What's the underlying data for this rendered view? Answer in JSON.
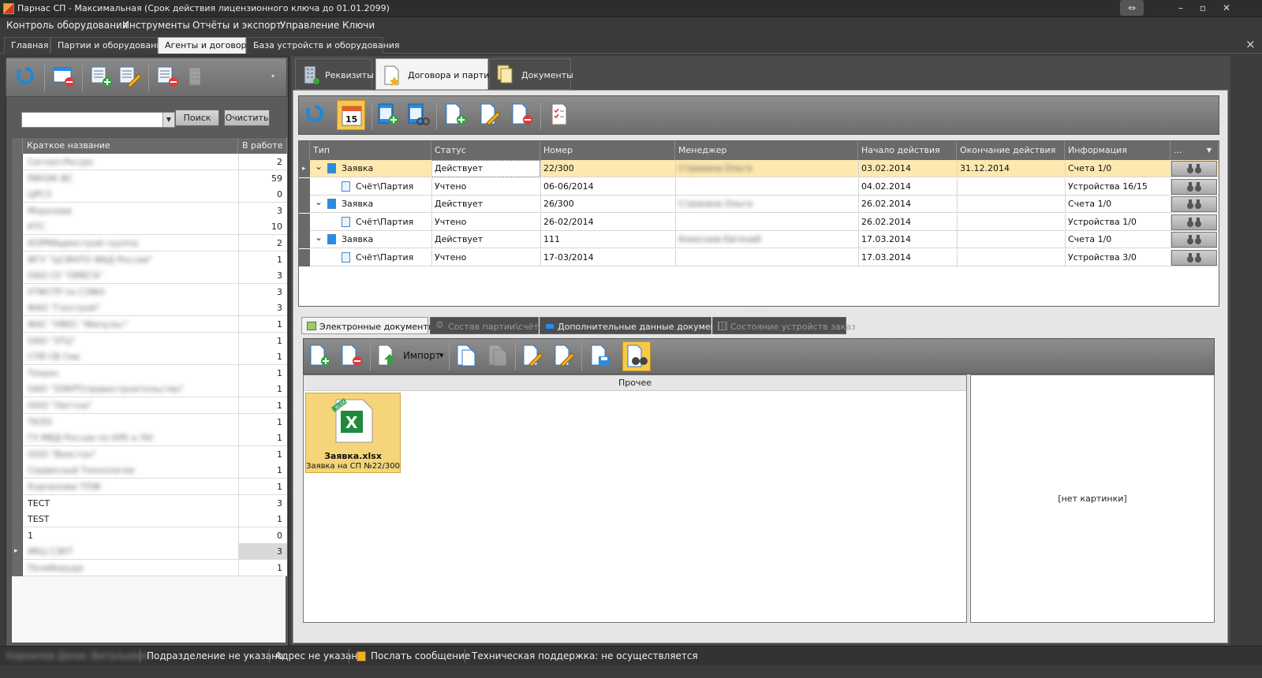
{
  "window": {
    "title": "Парнас СП - Максимальная (Срок действия лицензионного ключа до 01.01.2099)",
    "controls": {
      "restore": "⇔",
      "minimize": "–",
      "maximize": "▫",
      "close": "✕"
    }
  },
  "menu": [
    "Контроль оборудования",
    "Инструменты",
    "Отчёты и экспорт",
    "Управление",
    "Ключи"
  ],
  "main_tabs": [
    {
      "label": "Главная"
    },
    {
      "label": "Партии и оборудование"
    },
    {
      "label": "Агенты и договора",
      "active": true
    },
    {
      "label": "База устройств и оборудования"
    }
  ],
  "main_close": "×",
  "left": {
    "search_button": "Поиск",
    "clear_button": "Очистить",
    "columns": [
      "Краткое название",
      "В работе"
    ],
    "rows": [
      {
        "name": "Сигнал-Ресурс",
        "count": "2",
        "blurred": true
      },
      {
        "name": "РИНЭК ВС",
        "count": "59",
        "blurred": true
      },
      {
        "name": "ЦРСЗ",
        "count": "0",
        "blurred": true
      },
      {
        "name": "Морозова",
        "count": "3",
        "blurred": true
      },
      {
        "name": "КТС",
        "count": "10",
        "blurred": true
      },
      {
        "name": "КОРМАдмострой группа",
        "count": "2",
        "blurred": true
      },
      {
        "name": "ФГУ \"ЦСФНТО ФБД России\"",
        "count": "1",
        "blurred": true
      },
      {
        "name": "ОАО СУ \"ОМЕГА\"",
        "count": "3",
        "blurred": true
      },
      {
        "name": "УТФСТР по СЗФО",
        "count": "3",
        "blurred": true
      },
      {
        "name": "ФАО \"Газстрой\"",
        "count": "3",
        "blurred": true
      },
      {
        "name": "ФАС \"УФЕС \"Импульс\"",
        "count": "1",
        "blurred": true
      },
      {
        "name": "ОАО \"ЗТЦ\"",
        "count": "1",
        "blurred": true
      },
      {
        "name": "СТЙ СВ Сев",
        "count": "1",
        "blurred": true
      },
      {
        "name": "Техрос",
        "count": "1",
        "blurred": true
      },
      {
        "name": "ОАО \"ЭЗКРТ(правостроительство\"",
        "count": "1",
        "blurred": true
      },
      {
        "name": "ООО \"Литтна\"",
        "count": "1",
        "blurred": true
      },
      {
        "name": "ТКЛЭ",
        "count": "1",
        "blurred": true
      },
      {
        "name": "ГУ МВД России по КРЕ и ЛН",
        "count": "1",
        "blurred": true
      },
      {
        "name": "ООО \"Веестон\"",
        "count": "1",
        "blurred": true
      },
      {
        "name": "Сервисный Технологии",
        "count": "1",
        "blurred": true
      },
      {
        "name": "Корнилова ТПЖ",
        "count": "1",
        "blurred": true
      },
      {
        "name": "ТЕСТ",
        "count": "3",
        "blurred": false
      },
      {
        "name": "TEST",
        "count": "1",
        "blurred": false
      },
      {
        "name": "1",
        "count": "0",
        "blurred": false
      },
      {
        "name": "ИКЦ СЗКТ",
        "count": "3",
        "blurred": true,
        "current": true
      },
      {
        "name": "Полиборуда",
        "count": "1",
        "blurred": true
      }
    ]
  },
  "right_tabs": [
    {
      "label": "Реквизиты"
    },
    {
      "label": "Договора и партии",
      "active": true
    },
    {
      "label": "Документы"
    }
  ],
  "calendar_day": "15",
  "grid": {
    "columns": [
      "Тип",
      "Статус",
      "Номер",
      "Менеджер",
      "Начало действия",
      "Окончание действия",
      "Информация",
      "..."
    ],
    "rows": [
      {
        "level": 0,
        "type": "Заявка",
        "status": "Действует",
        "number": "22/300",
        "manager": "Строкина Ольга",
        "start": "03.02.2014",
        "end": "31.12.2014",
        "info": "Счета  1/0",
        "selected": true
      },
      {
        "level": 1,
        "type": "Счёт\\Партия",
        "status": "Учтено",
        "number": "06-06/2014",
        "manager": "",
        "start": "04.02.2014",
        "end": "",
        "info": "Устройства  16/15"
      },
      {
        "level": 0,
        "type": "Заявка",
        "status": "Действует",
        "number": "26/300",
        "manager": "Строкина Ольга",
        "start": "26.02.2014",
        "end": "",
        "info": "Счета  1/0"
      },
      {
        "level": 1,
        "type": "Счёт\\Партия",
        "status": "Учтено",
        "number": "26-02/2014",
        "manager": "",
        "start": "26.02.2014",
        "end": "",
        "info": "Устройства  1/0"
      },
      {
        "level": 0,
        "type": "Заявка",
        "status": "Действует",
        "number": "111",
        "manager": "Алексеев Евгений",
        "start": "17.03.2014",
        "end": "",
        "info": "Счета  1/0"
      },
      {
        "level": 1,
        "type": "Счёт\\Партия",
        "status": "Учтено",
        "number": "17-03/2014",
        "manager": "",
        "start": "17.03.2014",
        "end": "",
        "info": "Устройства  3/0"
      }
    ]
  },
  "bottom_tabs": [
    {
      "label": "Электронные документы",
      "state": "active"
    },
    {
      "label": "Состав партии\\счёта",
      "state": "disabled"
    },
    {
      "label": "Дополнительные данные документа",
      "state": "normal"
    },
    {
      "label": "Состояние устройств заказ",
      "state": "disabled"
    }
  ],
  "docs": {
    "import_label": "Импорт",
    "group_header": "Прочее",
    "file_name": "Заявка.xlsx",
    "file_desc": "Заявка на СП №22/300",
    "file_badge": "XLSX",
    "file_glyph": "X",
    "preview_text": "[нет картинки]"
  },
  "status": {
    "user": "Корнилов Денис Витальевич",
    "department": "Подразделение не указано",
    "address": "Адрес не указан",
    "send_message": "Послать сообщение",
    "support": "Техническая поддержка: не осуществляется"
  }
}
